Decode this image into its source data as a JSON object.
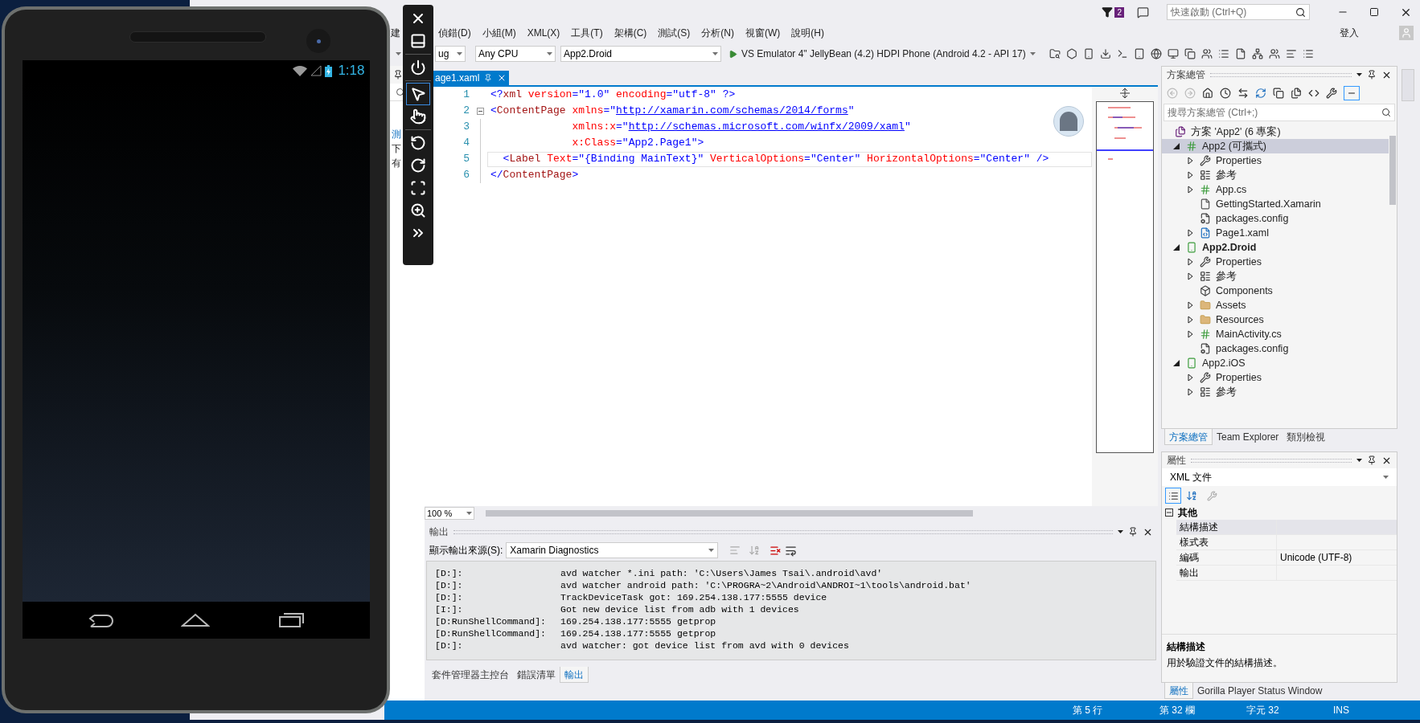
{
  "emulator": {
    "time": "1:18",
    "tool_groups": [
      [
        {
          "kind": "close",
          "selected": false
        },
        {
          "kind": "minimize",
          "selected": false
        }
      ],
      [
        {
          "kind": "power",
          "selected": false
        }
      ],
      [
        {
          "kind": "pointer",
          "selected": true
        },
        {
          "kind": "touch",
          "selected": false
        }
      ],
      [
        {
          "kind": "rotate-left",
          "selected": false
        },
        {
          "kind": "rotate-right",
          "selected": false
        },
        {
          "kind": "fit",
          "selected": false
        },
        {
          "kind": "zoom",
          "selected": false
        },
        {
          "kind": "more",
          "selected": false
        }
      ]
    ]
  },
  "ide": {
    "title_bar": {
      "notification_count": "2",
      "quick_launch_placeholder": "快速啟動 (Ctrl+Q)"
    },
    "menu": [
      "建",
      "偵錯(D)",
      "小組(M)",
      "XML(X)",
      "工具(T)",
      "架構(C)",
      "測試(S)",
      "分析(N)",
      "視窗(W)",
      "說明(H)"
    ],
    "sign_in": "登入",
    "toolbar": {
      "configuration": "ug",
      "platform": "Any CPU",
      "startup_project": "App2.Droid",
      "run_target": "VS Emulator 4\" JellyBean (4.2) HDPI Phone (Android 4.2 - API 17)"
    },
    "left_panel": {
      "fragments": [
        {
          "text": "測",
          "link": true
        },
        {
          "text": "下",
          "link": false
        },
        {
          "text": "有",
          "link": false
        }
      ]
    },
    "editor": {
      "tab": "age1.xaml",
      "zoom": "100 %",
      "lines": [
        {
          "number": "1",
          "current": false,
          "foldable": false,
          "tokens": [
            {
              "kind": "punct",
              "text": "<?"
            },
            {
              "kind": "element",
              "text": "xml"
            },
            {
              "kind": "attribute",
              "text": " version"
            },
            {
              "kind": "value",
              "text": "=\"1.0\""
            },
            {
              "kind": "attribute",
              "text": " encoding"
            },
            {
              "kind": "value",
              "text": "=\"utf-8\""
            },
            {
              "kind": "value",
              "text": " ?>"
            }
          ]
        },
        {
          "number": "2",
          "current": false,
          "foldable": true,
          "tokens": [
            {
              "kind": "punct",
              "text": "<"
            },
            {
              "kind": "element",
              "text": "ContentPage"
            },
            {
              "kind": "attribute",
              "text": " xmlns"
            },
            {
              "kind": "value",
              "text": "=\""
            },
            {
              "kind": "link",
              "text": "http://xamarin.com/schemas/2014/forms"
            },
            {
              "kind": "value",
              "text": "\""
            }
          ]
        },
        {
          "number": "3",
          "current": false,
          "foldable": false,
          "tokens": [
            {
              "kind": "attribute",
              "text": "             xmlns:x"
            },
            {
              "kind": "value",
              "text": "=\""
            },
            {
              "kind": "link",
              "text": "http://schemas.microsoft.com/winfx/2009/xaml"
            },
            {
              "kind": "value",
              "text": "\""
            }
          ]
        },
        {
          "number": "4",
          "current": false,
          "foldable": false,
          "tokens": [
            {
              "kind": "attribute",
              "text": "             x:Class"
            },
            {
              "kind": "value",
              "text": "=\"App2.Page1\">"
            }
          ]
        },
        {
          "number": "5",
          "current": true,
          "foldable": false,
          "tokens": [
            {
              "kind": "punct",
              "text": "  <"
            },
            {
              "kind": "element",
              "text": "Label"
            },
            {
              "kind": "attribute",
              "text": " Text"
            },
            {
              "kind": "value",
              "text": "=\"{Binding MainText}\""
            },
            {
              "kind": "attribute",
              "text": " VerticalOptions"
            },
            {
              "kind": "value",
              "text": "=\"Center\""
            },
            {
              "kind": "attribute",
              "text": " HorizontalOptions"
            },
            {
              "kind": "value",
              "text": "=\"Center\" />"
            }
          ]
        },
        {
          "number": "6",
          "current": false,
          "foldable": false,
          "tokens": [
            {
              "kind": "punct",
              "text": "</"
            },
            {
              "kind": "element",
              "text": "ContentPage"
            },
            {
              "kind": "punct",
              "text": ">"
            }
          ]
        }
      ]
    },
    "output": {
      "title": "輸出",
      "source_label": "顯示輸出來源(S):",
      "source": "Xamarin Diagnostics",
      "lines": [
        {
          "tag": "[D:]:",
          "message": "avd watcher *.ini path: 'C:\\Users\\James Tsai\\.android\\avd'"
        },
        {
          "tag": "[D:]:",
          "message": "avd watcher android path: 'C:\\PROGRA~2\\Android\\ANDROI~1\\tools\\android.bat'"
        },
        {
          "tag": "[D:]:",
          "message": "TrackDeviceTask got: 169.254.138.177:5555 device"
        },
        {
          "tag": "[I:]:",
          "message": "Got new device list from adb with 1 devices"
        },
        {
          "tag": "[D:RunShellCommand]:",
          "message": "169.254.138.177:5555 getprop"
        },
        {
          "tag": "[D:RunShellCommand]:",
          "message": "169.254.138.177:5555 getprop"
        },
        {
          "tag": "[D:]:",
          "message": "avd watcher: got device list from avd with 0 devices"
        }
      ],
      "tabs": [
        {
          "label": "套件管理器主控台",
          "selected": false
        },
        {
          "label": "錯誤清單",
          "selected": false
        },
        {
          "label": "輸出",
          "selected": true
        }
      ]
    },
    "solution": {
      "title": "方案總管",
      "search_placeholder": "搜尋方案總管 (Ctrl+;)",
      "tree": {
        "label": "方案 'App2' (6 專案)",
        "kind": "solution",
        "selected": false,
        "children": [
          {
            "label": "App2 (可攜式)",
            "kind": "csharp-project",
            "expanded": true,
            "selected": true,
            "startup": false,
            "children": [
              {
                "label": "Properties",
                "kind": "wrench",
                "expanded": false,
                "selected": false
              },
              {
                "label": "參考",
                "kind": "references",
                "expanded": false,
                "selected": false
              },
              {
                "label": "App.cs",
                "kind": "cs-file",
                "expanded": false,
                "selected": false
              },
              {
                "label": "GettingStarted.Xamarin",
                "kind": "file",
                "selected": false
              },
              {
                "label": "packages.config",
                "kind": "config",
                "selected": false
              },
              {
                "label": "Page1.xaml",
                "kind": "xaml",
                "expanded": false,
                "selected": false
              }
            ]
          },
          {
            "label": "App2.Droid",
            "kind": "android-project",
            "expanded": true,
            "selected": false,
            "startup": true,
            "children": [
              {
                "label": "Properties",
                "kind": "wrench",
                "expanded": false,
                "selected": false
              },
              {
                "label": "參考",
                "kind": "references",
                "expanded": false,
                "selected": false
              },
              {
                "label": "Components",
                "kind": "component",
                "selected": false
              },
              {
                "label": "Assets",
                "kind": "folder",
                "expanded": false,
                "selected": false
              },
              {
                "label": "Resources",
                "kind": "folder",
                "expanded": false,
                "selected": false
              },
              {
                "label": "MainActivity.cs",
                "kind": "cs-file",
                "expanded": false,
                "selected": false
              },
              {
                "label": "packages.config",
                "kind": "config",
                "selected": false
              }
            ]
          },
          {
            "label": "App2.iOS",
            "kind": "ios-project",
            "expanded": true,
            "selected": false,
            "startup": false,
            "children": [
              {
                "label": "Properties",
                "kind": "wrench",
                "expanded": false,
                "selected": false
              },
              {
                "label": "參考",
                "kind": "references",
                "expanded": false,
                "selected": false
              }
            ]
          }
        ]
      },
      "tabs": [
        {
          "label": "方案總管",
          "selected": true
        },
        {
          "label": "Team Explorer",
          "selected": false
        },
        {
          "label": "類別檢視",
          "selected": false
        }
      ]
    },
    "properties": {
      "title": "屬性",
      "object": "XML 文件",
      "category": {
        "label": "其他",
        "expanded": true,
        "rows": [
          {
            "name": "結構描述",
            "selected": true
          },
          {
            "name": "樣式表",
            "selected": false
          },
          {
            "name": "編碼",
            "value": "Unicode (UTF-8)",
            "selected": false
          },
          {
            "name": "輸出",
            "selected": false
          }
        ]
      },
      "description": {
        "title": "結構描述",
        "text": "用於驗證文件的結構描述。"
      },
      "tabs": [
        {
          "label": "屬性",
          "selected": true
        },
        {
          "label": "Gorilla Player Status Window",
          "selected": false
        }
      ]
    },
    "status_bar": [
      "第 5 行",
      "第 32 欄",
      "字元 32",
      "INS"
    ]
  }
}
